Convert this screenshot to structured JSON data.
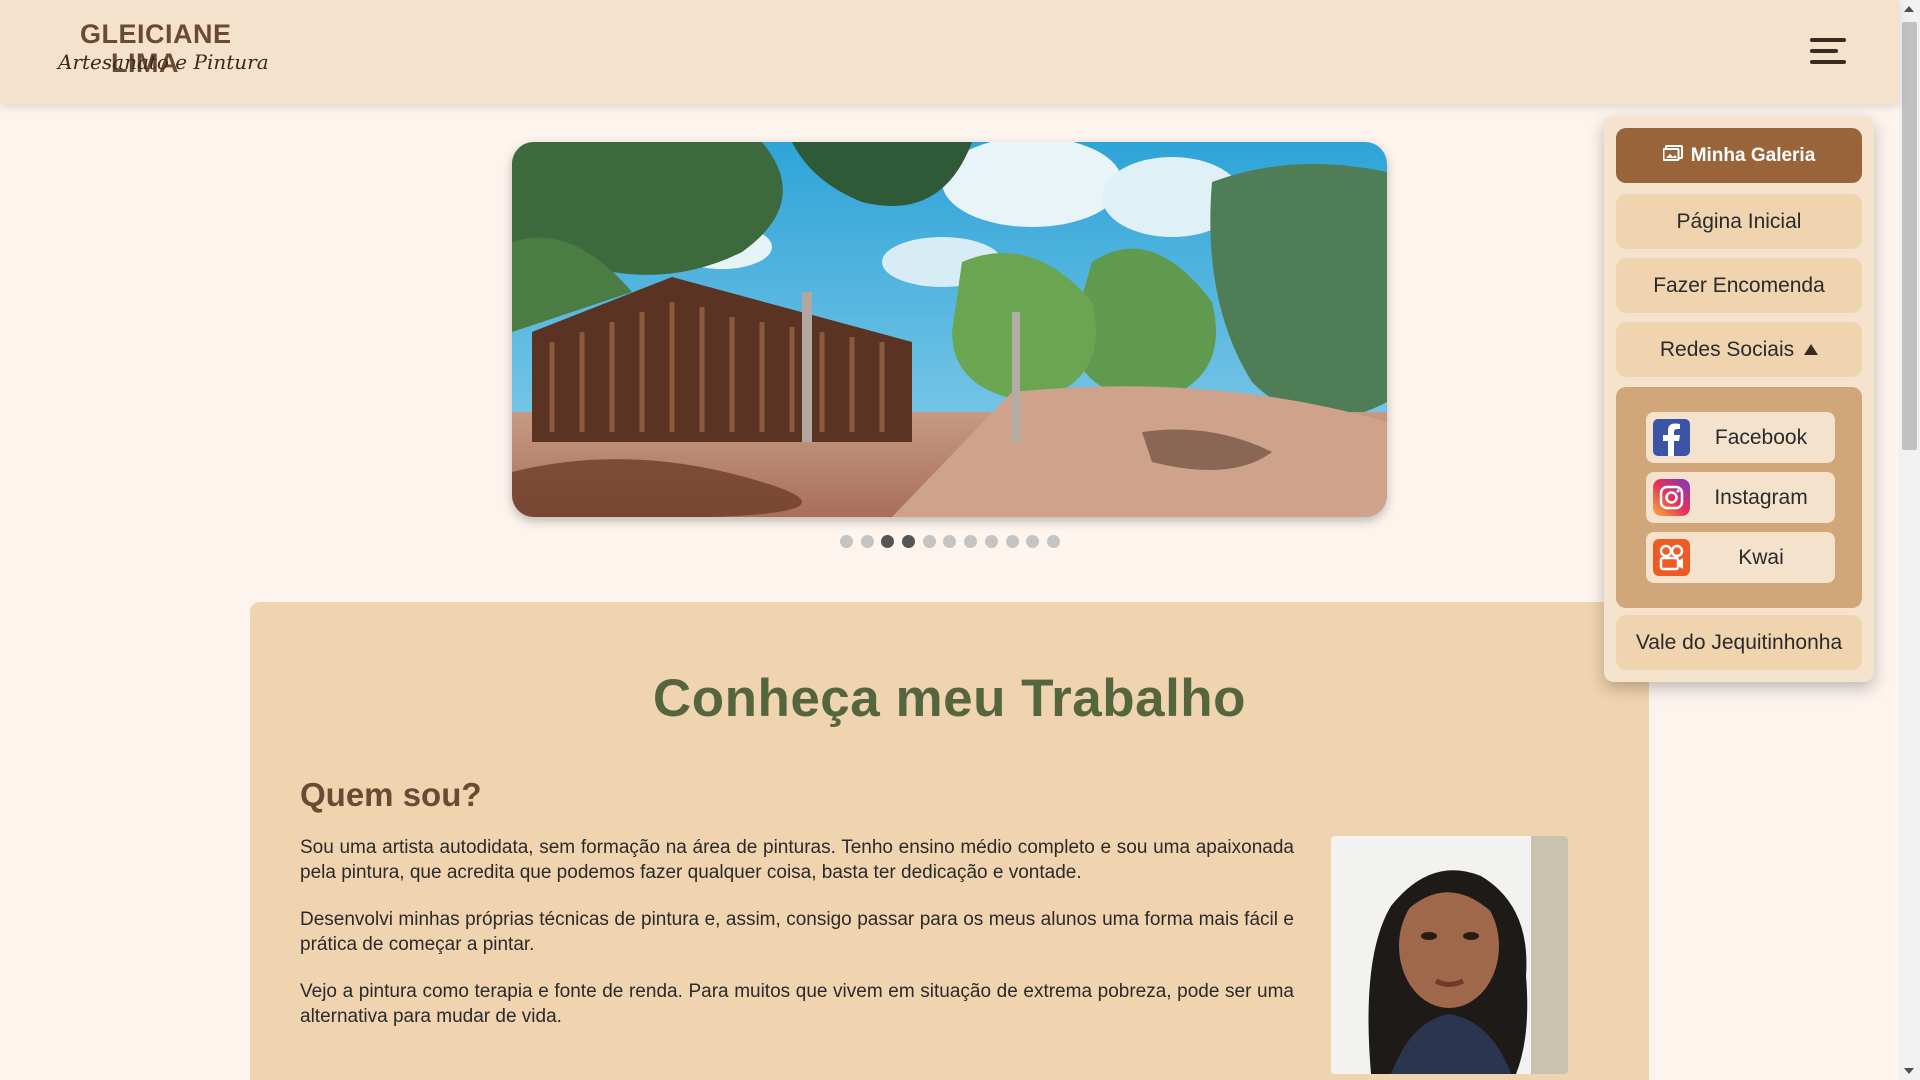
{
  "header": {
    "logo_name": "GLEICIANE LIMA",
    "logo_tagline": "Artesanato e Pintura",
    "menu_icon": "hamburger-menu-icon"
  },
  "carousel": {
    "image_description_icon": "painting-landscape-image",
    "dots_total": 11,
    "active_dots": [
      3,
      4
    ]
  },
  "main": {
    "title": "Conheça meu Trabalho",
    "section_title": "Quem sou?",
    "paragraphs": [
      "Sou uma artista autodidata, sem formação na área de pinturas. Tenho ensino médio completo e sou uma apaixonada pela pintura, que acredita que podemos fazer qualquer coisa, basta ter dedicação e vontade.",
      "Desenvolvi minhas próprias técnicas de pintura e, assim, consigo passar para os meus alunos uma forma mais fácil e prática de começar a pintar.",
      "Vejo a pintura como terapia e fonte de renda. Para muitos que vivem em situação de extrema pobreza, pode ser uma alternativa para mudar de vida."
    ]
  },
  "menu": {
    "gallery_label": "Minha Galeria",
    "home_label": "Página Inicial",
    "order_label": "Fazer Encomenda",
    "social_label": "Redes Sociais",
    "social": [
      {
        "label": "Facebook",
        "icon": "facebook-icon",
        "color": "#3b55a5"
      },
      {
        "label": "Instagram",
        "icon": "instagram-icon",
        "color": "#d6397a"
      },
      {
        "label": "Kwai",
        "icon": "kwai-icon",
        "color": "#f05a24"
      }
    ],
    "valley_label": "Vale do Jequitinhonha"
  },
  "colors": {
    "header_bg": "#f5e2cc",
    "card_bg": "#f0d4b0",
    "title_green": "#55663f",
    "brown_accent": "#9a643a"
  }
}
